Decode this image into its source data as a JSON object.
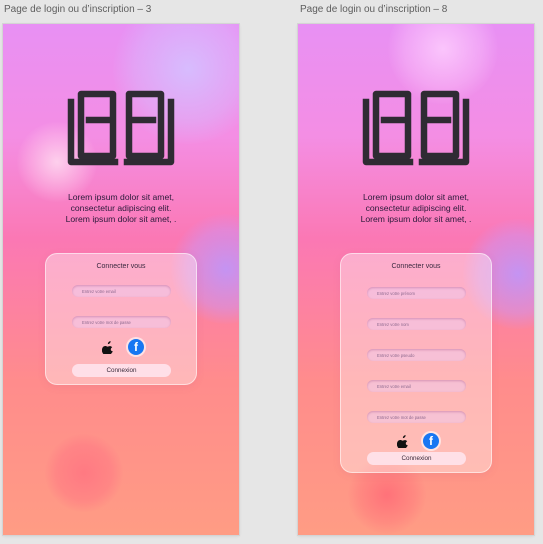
{
  "artboards": [
    {
      "title": "Page de login ou d’inscription – 3",
      "tagline": [
        "Lorem ipsum dolor sit amet,",
        "consectetur adipiscing elit.",
        "Lorem ipsum dolor sit amet, ."
      ],
      "card": {
        "title": "Connecter vous",
        "fields": [
          {
            "placeholder": "Entrez votre email"
          },
          {
            "placeholder": "Entrez votre mot de passe"
          }
        ],
        "social": [
          "apple-icon",
          "facebook-icon"
        ],
        "button": "Connexion"
      }
    },
    {
      "title": "Page de login ou d’inscription – 8",
      "tagline": [
        "Lorem ipsum dolor sit amet,",
        "consectetur adipiscing elit.",
        "Lorem ipsum dolor sit amet, ."
      ],
      "card": {
        "title": "Connecter vous",
        "fields": [
          {
            "placeholder": "Entrez votre prénom"
          },
          {
            "placeholder": "Entrez votre nom"
          },
          {
            "placeholder": "Entrez votre pseudo"
          },
          {
            "placeholder": "Entrez votre email"
          },
          {
            "placeholder": "Entrez votre mot de passe"
          }
        ],
        "social": [
          "apple-icon",
          "facebook-icon"
        ],
        "button": "Connexion"
      }
    }
  ],
  "icons": {
    "facebook_glyph": "f",
    "apple_glyph": ""
  },
  "colors": {
    "facebook": "#1877f2",
    "logo": "#2f2b33"
  }
}
